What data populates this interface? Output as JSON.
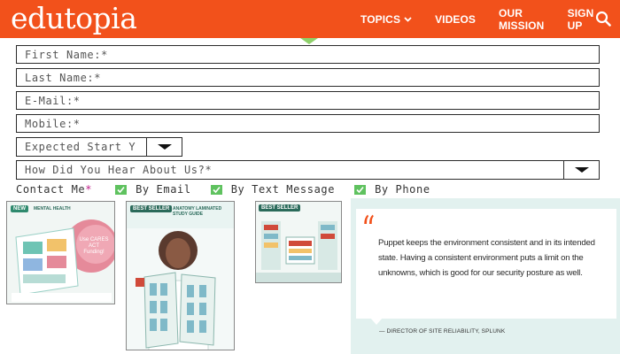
{
  "header": {
    "logo": "edutopia",
    "nav": [
      {
        "label": "TOPICS",
        "has_dropdown": true
      },
      {
        "label": "VIDEOS"
      },
      {
        "label": "OUR MISSION"
      },
      {
        "label": "SIGN UP"
      }
    ],
    "search_icon": "search-icon"
  },
  "form": {
    "first_name_placeholder": "First Name:*",
    "last_name_placeholder": "Last Name:*",
    "email_placeholder": "E-Mail:*",
    "mobile_placeholder": "Mobile:*",
    "start_select": "Expected Start Y",
    "hear_select": "How Did You Hear About Us?*",
    "contact_label": "Contact Me",
    "contact_req": "*",
    "contact_options": [
      "By Email",
      "By Text Message",
      "By Phone"
    ]
  },
  "products": {
    "p1_badge": "NEW",
    "p1_title": "MENTAL HEALTH",
    "p1_cares": "Use CARES ACT Funding!",
    "p2_badge": "BEST SELLER",
    "p2_title": "ANATOMY LAMINATED STUDY GUIDE",
    "p3_badge": "BEST SELLER"
  },
  "quote": {
    "mark": "“",
    "text": "Puppet keeps the environment consistent and in its intended state. Having a consistent environment puts a limit on the unknowns, which is good for our security posture as well.",
    "attribution": "— DIRECTOR OF SITE RELIABILITY, SPLUNK"
  },
  "colors": {
    "brand": "#f2511b",
    "check": "#5fc25f",
    "quote_bg": "#e2f1ef"
  }
}
